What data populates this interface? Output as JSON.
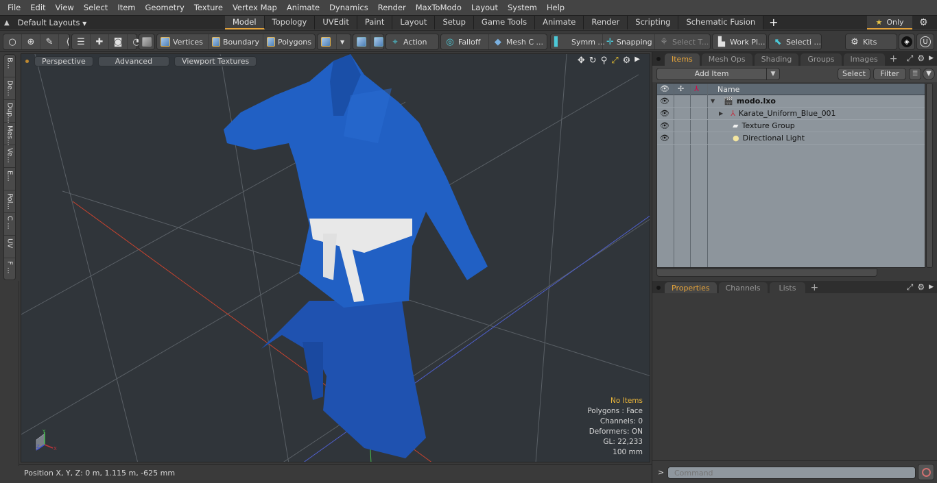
{
  "menubar": {
    "items": [
      "File",
      "Edit",
      "View",
      "Select",
      "Item",
      "Geometry",
      "Texture",
      "Vertex Map",
      "Animate",
      "Dynamics",
      "Render",
      "MaxToModo",
      "Layout",
      "System",
      "Help"
    ]
  },
  "layoutbar": {
    "layouts_dropdown": "Default Layouts",
    "tabs": [
      "Model",
      "Topology",
      "UVEdit",
      "Paint",
      "Layout",
      "Setup",
      "Game Tools",
      "Animate",
      "Render",
      "Scripting",
      "Schematic Fusion"
    ],
    "active_tab": "Model",
    "add_tab": "+",
    "only_label": "Only"
  },
  "toolbar": {
    "vertices": "Vertices",
    "boundary": "Boundary",
    "polygons": "Polygons",
    "action": "Action",
    "action_more": "...",
    "falloff": "Falloff",
    "mesh_c": "Mesh C ...",
    "symm": "Symm ...",
    "snapping": "Snapping",
    "select_t": "Select T...",
    "work_pl": "Work Pl...",
    "selecti": "Selecti ...",
    "kits": "Kits"
  },
  "left_tabs": [
    "B...",
    "De...",
    "Dup...",
    "Mes...",
    "Ve...",
    "E...",
    "Pol...",
    "C ...",
    "UV",
    "F ..."
  ],
  "viewport": {
    "view_mode": "Perspective",
    "shading": "Advanced",
    "textures": "Viewport Textures",
    "stats": {
      "selection": "No Items",
      "polygons": "Polygons : Face",
      "channels": "Channels: 0",
      "deformers": "Deformers: ON",
      "gl": "GL: 22,233",
      "grid": "100 mm"
    },
    "gizmo": {
      "x": "X",
      "y": "Y",
      "z": "Z"
    },
    "colors": {
      "background": "#30353a",
      "cloth": "#1f56b8",
      "belt": "#e6e6e6",
      "x_axis": "#d0402e",
      "z_axis": "#4a5fd0",
      "y_axis": "#3cb84a"
    }
  },
  "statusbar": {
    "position": "Position X, Y, Z:   0 m, 1.115 m, -625 mm"
  },
  "items_panel": {
    "tabs": [
      "Items",
      "Mesh Ops",
      "Shading",
      "Groups",
      "Images"
    ],
    "active_tab": "Items",
    "add_item": "Add Item",
    "select": "Select",
    "filter": "Filter",
    "column_name": "Name",
    "rows": [
      {
        "name": "modo.lxo",
        "bold": true,
        "expander": "▼"
      },
      {
        "name": "Karate_Uniform_Blue_001",
        "bold": false,
        "expander": "▶"
      },
      {
        "name": "Texture Group",
        "bold": false,
        "expander": ""
      },
      {
        "name": "Directional Light",
        "bold": false,
        "expander": ""
      }
    ]
  },
  "properties_panel": {
    "tabs": [
      "Properties",
      "Channels",
      "Lists"
    ],
    "active_tab": "Properties"
  },
  "command": {
    "prompt": ">",
    "placeholder": "Command"
  },
  "accent_color": "#e4a33a"
}
